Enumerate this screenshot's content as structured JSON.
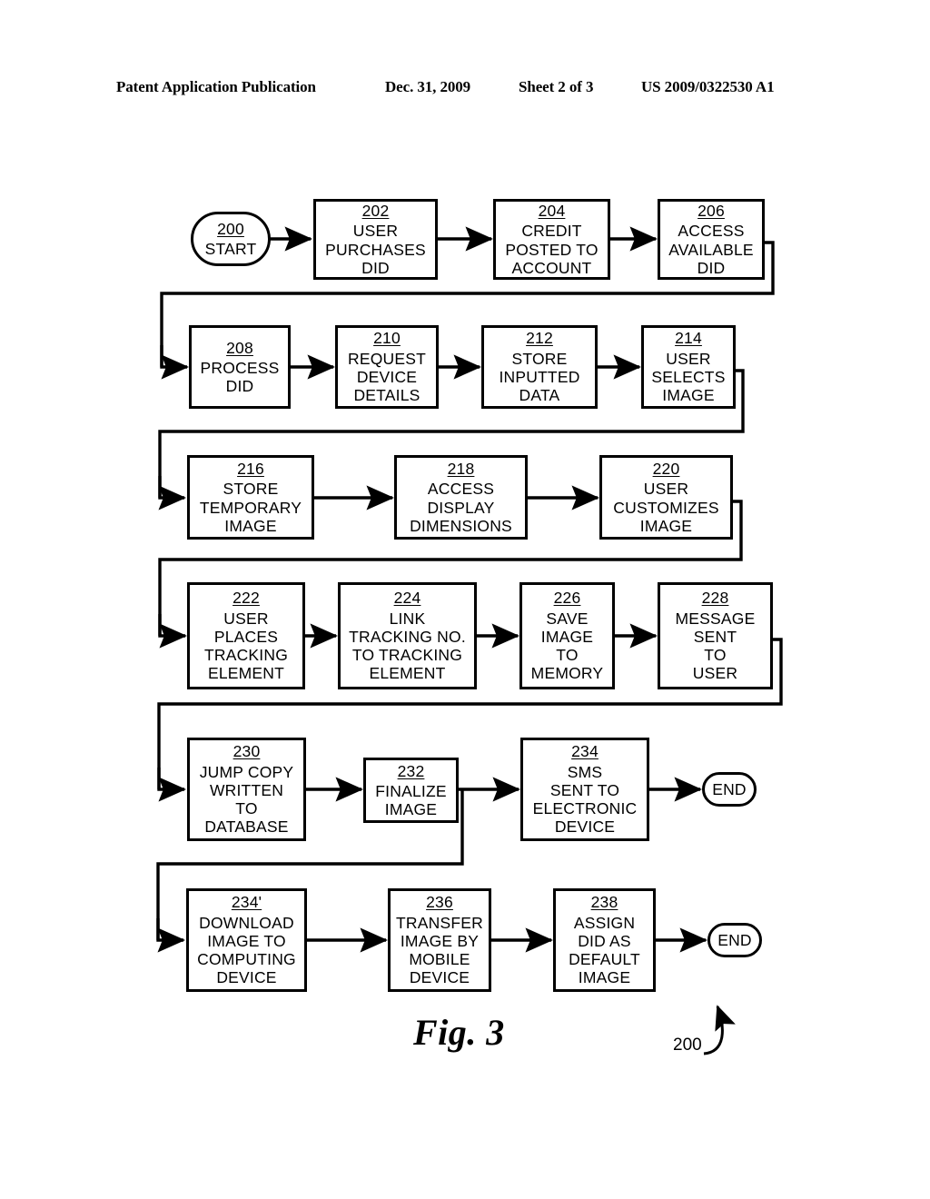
{
  "header": {
    "publication": "Patent Application Publication",
    "date": "Dec. 31, 2009",
    "sheet": "Sheet 2 of 3",
    "number": "US 2009/0322530 A1"
  },
  "figure": {
    "caption": "Fig. 3",
    "leader_label": "200"
  },
  "flowchart": {
    "nodes": [
      {
        "id": "n200",
        "ref": "200",
        "label": "START",
        "shape": "terminal"
      },
      {
        "id": "n202",
        "ref": "202",
        "label": "USER\nPURCHASES\nDID",
        "shape": "box"
      },
      {
        "id": "n204",
        "ref": "204",
        "label": "CREDIT\nPOSTED TO\nACCOUNT",
        "shape": "box"
      },
      {
        "id": "n206",
        "ref": "206",
        "label": "ACCESS\nAVAILABLE\nDID",
        "shape": "box"
      },
      {
        "id": "n208",
        "ref": "208",
        "label": "PROCESS\nDID",
        "shape": "box"
      },
      {
        "id": "n210",
        "ref": "210",
        "label": "REQUEST\nDEVICE\nDETAILS",
        "shape": "box"
      },
      {
        "id": "n212",
        "ref": "212",
        "label": "STORE\nINPUTTED\nDATA",
        "shape": "box"
      },
      {
        "id": "n214",
        "ref": "214",
        "label": "USER\nSELECTS\nIMAGE",
        "shape": "box"
      },
      {
        "id": "n216",
        "ref": "216",
        "label": "STORE\nTEMPORARY\nIMAGE",
        "shape": "box"
      },
      {
        "id": "n218",
        "ref": "218",
        "label": "ACCESS\nDISPLAY\nDIMENSIONS",
        "shape": "box"
      },
      {
        "id": "n220",
        "ref": "220",
        "label": "USER\nCUSTOMIZES\nIMAGE",
        "shape": "box"
      },
      {
        "id": "n222",
        "ref": "222",
        "label": "USER\nPLACES\nTRACKING\nELEMENT",
        "shape": "box"
      },
      {
        "id": "n224",
        "ref": "224",
        "label": "LINK\nTRACKING NO.\nTO TRACKING\nELEMENT",
        "shape": "box"
      },
      {
        "id": "n226",
        "ref": "226",
        "label": "SAVE\nIMAGE\nTO\nMEMORY",
        "shape": "box"
      },
      {
        "id": "n228",
        "ref": "228",
        "label": "MESSAGE\nSENT\nTO\nUSER",
        "shape": "box"
      },
      {
        "id": "n230",
        "ref": "230",
        "label": "JUMP COPY\nWRITTEN\nTO\nDATABASE",
        "shape": "box"
      },
      {
        "id": "n232",
        "ref": "232",
        "label": "FINALIZE\nIMAGE",
        "shape": "box"
      },
      {
        "id": "n234",
        "ref": "234",
        "label": "SMS\nSENT TO\nELECTRONIC\nDEVICE",
        "shape": "box"
      },
      {
        "id": "end1",
        "ref": "",
        "label": "END",
        "shape": "terminal"
      },
      {
        "id": "n234p",
        "ref": "234'",
        "label": "DOWNLOAD\nIMAGE TO\nCOMPUTING\nDEVICE",
        "shape": "box"
      },
      {
        "id": "n236",
        "ref": "236",
        "label": "TRANSFER\nIMAGE BY\nMOBILE\nDEVICE",
        "shape": "box"
      },
      {
        "id": "n238",
        "ref": "238",
        "label": "ASSIGN\nDID AS\nDEFAULT\nIMAGE",
        "shape": "box"
      },
      {
        "id": "end2",
        "ref": "",
        "label": "END",
        "shape": "terminal"
      }
    ],
    "edges": [
      {
        "from": "n200",
        "to": "n202"
      },
      {
        "from": "n202",
        "to": "n204"
      },
      {
        "from": "n204",
        "to": "n206"
      },
      {
        "from": "n206",
        "to": "n208"
      },
      {
        "from": "n208",
        "to": "n210"
      },
      {
        "from": "n210",
        "to": "n212"
      },
      {
        "from": "n212",
        "to": "n214"
      },
      {
        "from": "n214",
        "to": "n216"
      },
      {
        "from": "n216",
        "to": "n218"
      },
      {
        "from": "n218",
        "to": "n220"
      },
      {
        "from": "n220",
        "to": "n222"
      },
      {
        "from": "n222",
        "to": "n224"
      },
      {
        "from": "n224",
        "to": "n226"
      },
      {
        "from": "n226",
        "to": "n228"
      },
      {
        "from": "n228",
        "to": "n230"
      },
      {
        "from": "n230",
        "to": "n232"
      },
      {
        "from": "n232",
        "to": "n234"
      },
      {
        "from": "n234",
        "to": "end1"
      },
      {
        "from": "n232",
        "to": "n234p"
      },
      {
        "from": "n234p",
        "to": "n236"
      },
      {
        "from": "n236",
        "to": "n238"
      },
      {
        "from": "n238",
        "to": "end2"
      }
    ]
  }
}
